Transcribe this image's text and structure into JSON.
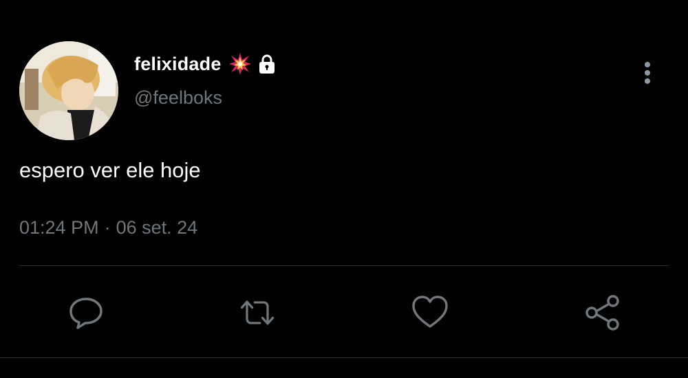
{
  "tweet": {
    "author": {
      "display_name": "felixidade",
      "handle": "@feelboks",
      "badge_icon": "collision-emoji-icon",
      "protected_icon": "lock-icon"
    },
    "text": "espero ver ele hoje",
    "time": "01:24 PM",
    "separator": "·",
    "date": "06 set. 24"
  },
  "actions": [
    {
      "name": "reply",
      "icon": "speech-bubble-icon"
    },
    {
      "name": "retweet",
      "icon": "retweet-icon"
    },
    {
      "name": "like",
      "icon": "heart-icon"
    },
    {
      "name": "share",
      "icon": "share-icon"
    }
  ],
  "colors": {
    "background": "#000000",
    "primary_text": "#ffffff",
    "secondary_text": "#71767b",
    "divider": "#2f3336",
    "badge": "#e0245e"
  }
}
